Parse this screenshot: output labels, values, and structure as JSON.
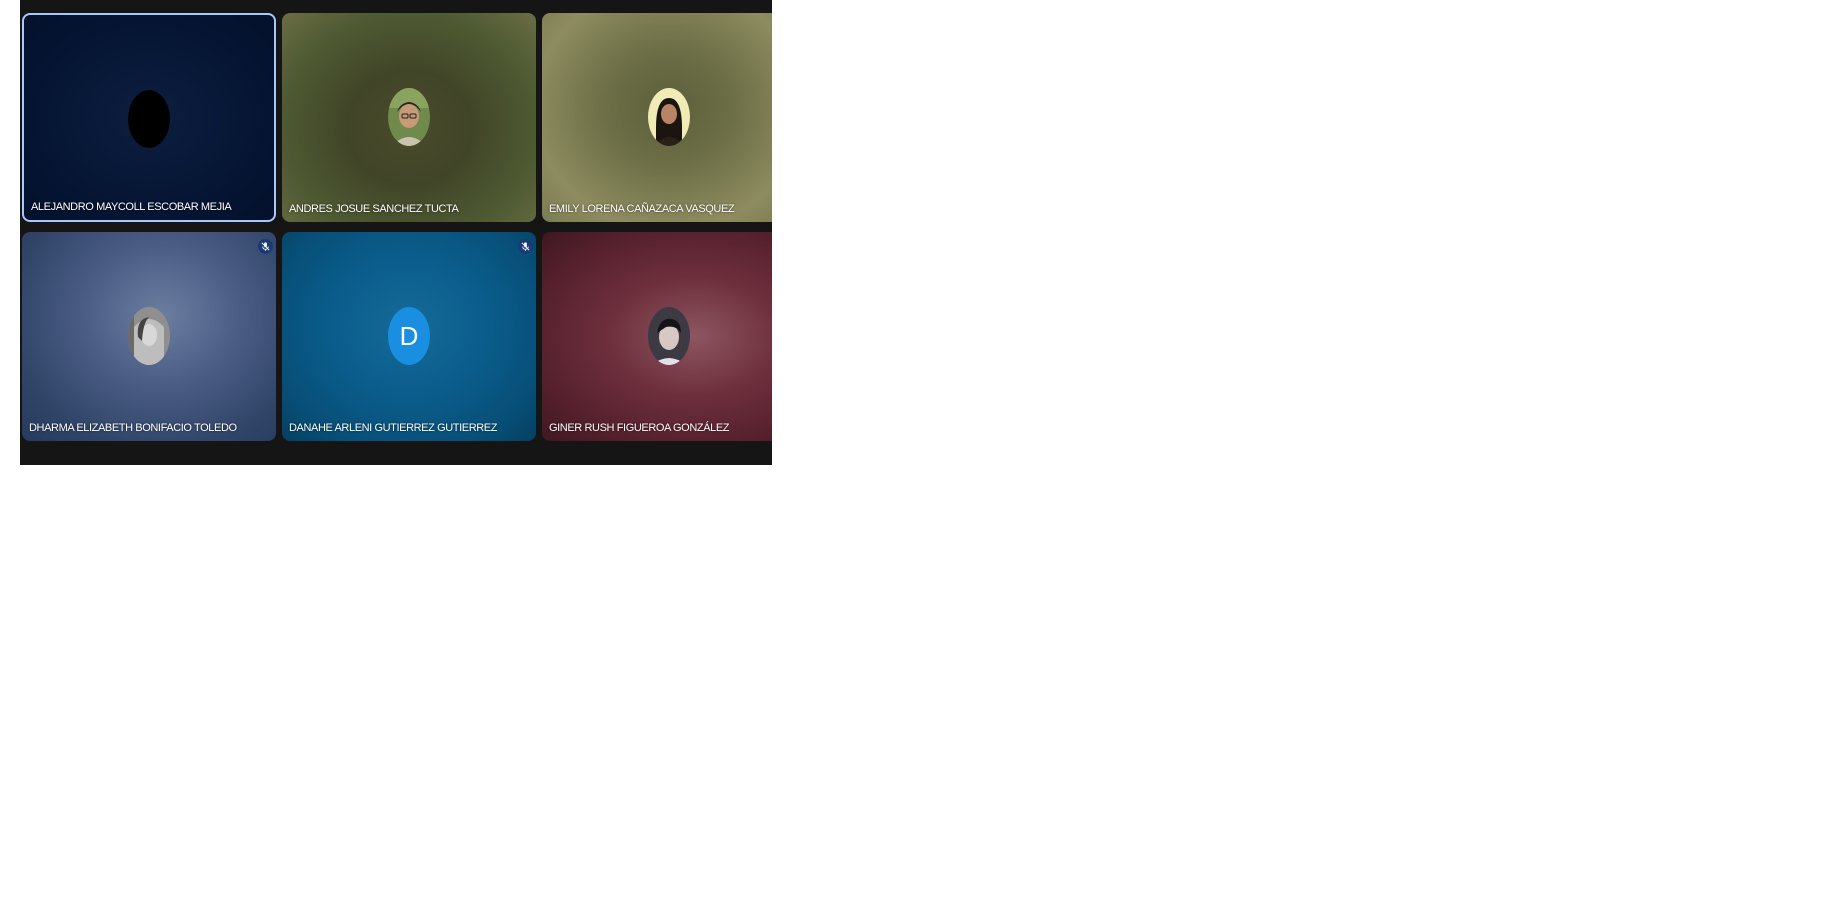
{
  "participants": [
    {
      "name": "ALEJANDRO MAYCOLL ESCOBAR MEJIA",
      "avatar": "black-circle-avatar",
      "active": true,
      "muted": false
    },
    {
      "name": "ANDRES JOSUE SANCHEZ TUCTA",
      "avatar": "photo-avatar",
      "active": false,
      "muted": false
    },
    {
      "name": "EMILY LORENA CAÑAZACA VASQUEZ",
      "avatar": "photo-avatar",
      "active": false,
      "muted": false
    },
    {
      "name": "DHARMA ELIZABETH BONIFACIO TOLEDO",
      "avatar": "photo-avatar",
      "active": false,
      "muted": true
    },
    {
      "name": "DANAHE ARLENI GUTIERREZ GUTIERREZ",
      "avatar": "letter-avatar",
      "initial": "D",
      "active": false,
      "muted": true
    },
    {
      "name": "GINER RUSH FIGUEROA GONZÁLEZ",
      "avatar": "photo-avatar",
      "active": false,
      "muted": false
    }
  ],
  "colors": {
    "background": "#151515",
    "active_border": "#a8c7fa",
    "letter_avatar": "#1a8ee0",
    "mic_badge": "#1a3a73"
  },
  "icons": [
    "mic-off-icon"
  ]
}
